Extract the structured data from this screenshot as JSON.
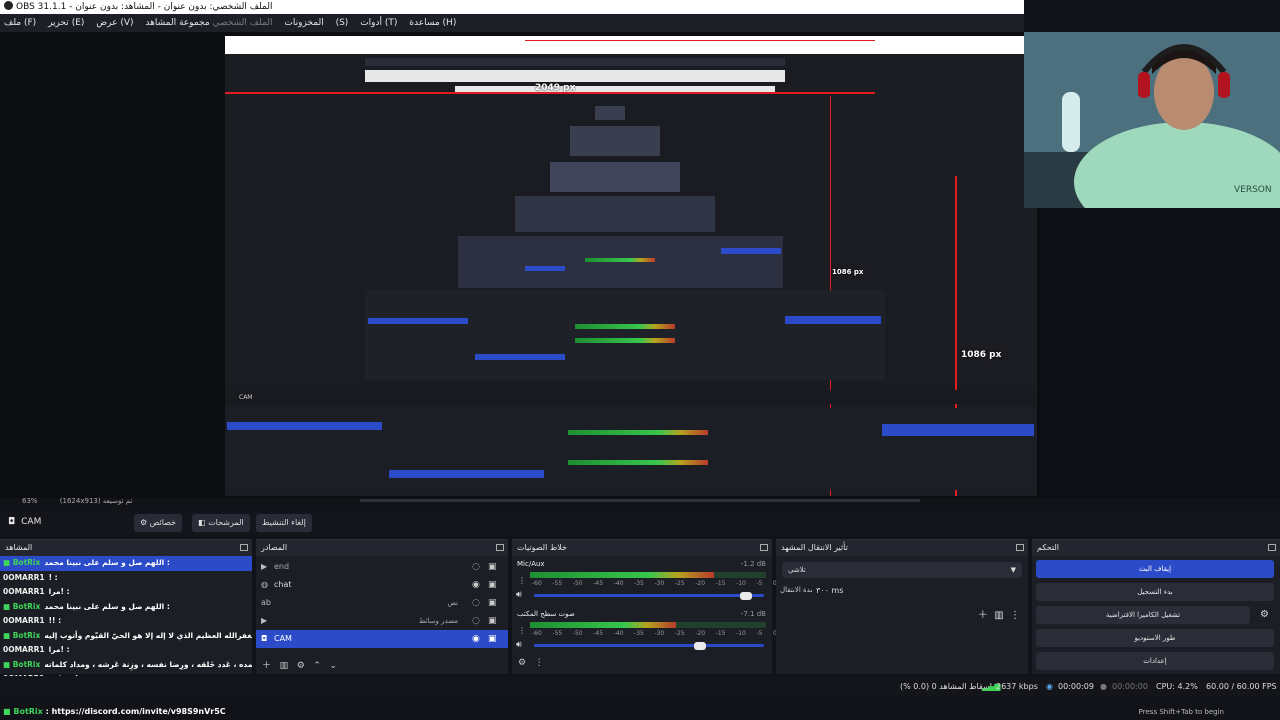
{
  "window": {
    "title": "OBS 31.1.1 - الملف الشخصي: بدون عنوان - المشاهد: بدون عنوان"
  },
  "menu": {
    "items": [
      {
        "label": "ملف (F)",
        "dim": false
      },
      {
        "label": "تحرير (E)",
        "dim": false
      },
      {
        "label": "عرض (V)",
        "dim": false
      },
      {
        "label": "المخزونات",
        "dim": false
      },
      {
        "label": "الملف الشخصي",
        "dim": true
      },
      {
        "label": "مجموعة المشاهد (S)",
        "dim": false
      },
      {
        "label": "أدوات (T)",
        "dim": false
      },
      {
        "label": "مساعدة (H)",
        "dim": false
      }
    ]
  },
  "preview": {
    "label_top": "2049 px",
    "label_mid": "1086 px",
    "label_right": "1086 px",
    "zoom": "63%",
    "canvas_info": "(1624x913) تم توسيعه",
    "webcam_shirt_text": "VERSON"
  },
  "scene_toolbar": {
    "source_name": "CAM",
    "properties": "خصائص",
    "filters": "المرشحات",
    "deactivate": "إلغاء التنشيط"
  },
  "docks": {
    "scenes_title": "المشاهد",
    "sources_title": "المصادر",
    "mixer_title": "خلاط الصوتيات",
    "transitions_title": "تأثير الانتقال المشهد",
    "controls_title": "التحكم"
  },
  "chat": {
    "rows": [
      {
        "name": "BotRix",
        "text": "اللهم صل و سلم على نبينا محمد :",
        "bot": true,
        "selected": true
      },
      {
        "name": "0OMARR1",
        "text": "! :",
        "bot": false,
        "selected": false
      },
      {
        "name": "0OMARR1",
        "text": "مرا! :",
        "bot": false,
        "selected": false
      },
      {
        "name": "BotRix",
        "text": "اللهم صل و سلم على نبينا محمد :",
        "bot": true,
        "selected": false
      },
      {
        "name": "0OMARR1",
        "text": "!! :",
        "bot": false,
        "selected": false
      },
      {
        "name": "BotRix",
        "text": "استغفرالله العظيم الذي لا إله إلا هو الحيّ القيّوم وأتوب إليه :",
        "bot": true,
        "selected": false
      },
      {
        "name": "0OMARR1",
        "text": "مرا! :",
        "bot": false,
        "selected": false
      },
      {
        "name": "BotRix",
        "text": "سُبحان الله وبحمده ، عَدد خَلقه ، ورِضا نفسه ، وزِنة عَرشه ، ومداد كلماته :",
        "bot": true,
        "selected": false
      },
      {
        "name": "0OMARR1",
        "text": "حسابي! :",
        "bot": false,
        "selected": false
      },
      {
        "name": "0OMARR1",
        "text": "! :",
        "bot": false,
        "selected": false
      }
    ],
    "footer_name": "BotRix",
    "footer_text": ": https://discord.com/invite/v98S9nVr5C"
  },
  "sources": {
    "items": [
      {
        "name": "end",
        "icon": "play-icon",
        "selected": false
      },
      {
        "name": "chat",
        "icon": "globe-icon",
        "selected": false
      },
      {
        "name": "",
        "icon": "font-icon",
        "selected": false
      },
      {
        "name": "",
        "icon": "play-icon",
        "selected": false
      },
      {
        "name": "CAM",
        "icon": "camera-icon",
        "selected": true
      }
    ],
    "extra_label_1": "نص",
    "extra_label_2": "مصدر وسائط"
  },
  "mixer": {
    "channels": [
      {
        "name": "Mic/Aux",
        "db": "-1.2 dB",
        "level": 0.78,
        "volume": 0.92
      },
      {
        "name": "صوت سطح المكتب",
        "db": "-7.1 dB",
        "level": 0.62,
        "volume": 0.72
      }
    ],
    "scale": [
      "-60",
      "-55",
      "-50",
      "-45",
      "-40",
      "-35",
      "-30",
      "-25",
      "-20",
      "-15",
      "-10",
      "-5",
      "0"
    ]
  },
  "transitions": {
    "current": "تلاشي",
    "duration_label": "مدة الانتقال",
    "duration_value": "٣٠٠ ms"
  },
  "controls": {
    "stop_stream": "إيقاف البث",
    "start_recording": "بدء التسجيل",
    "virtual_camera": "تشغيل الكاميرا الافتراضية",
    "studio_mode": "طور الاستوديو",
    "settings": "إعدادات"
  },
  "status": {
    "dropped": "إسقاط المشاهد 0 (0.0 %)",
    "bitrate": "2637 kbps",
    "stream_time": "00:00:09",
    "rec_time": "00:00:00",
    "cpu": "CPU: 4.2%",
    "fps": "60.00 / 60.00 FPS"
  },
  "hint": "Press Shift+Tab to begin",
  "colors": {
    "accent": "#2b4bc8",
    "bot": "#3fd45a",
    "guide_red": "#e01b24"
  }
}
